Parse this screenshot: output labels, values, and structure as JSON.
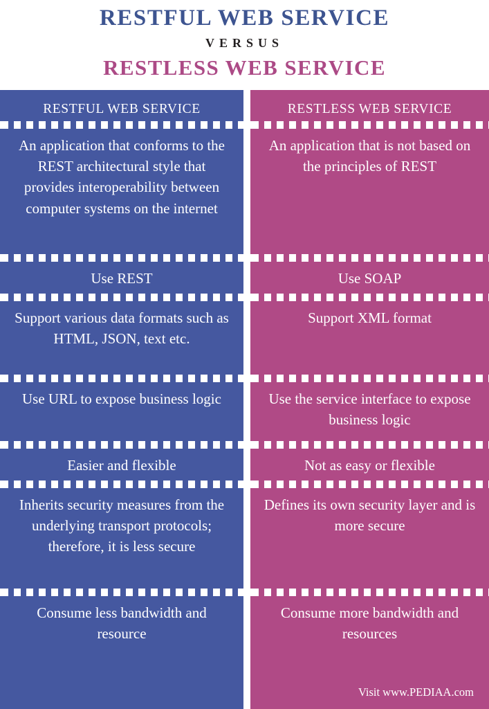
{
  "title": {
    "main": "RESTFUL WEB SERVICE",
    "versus": "VERSUS",
    "sub": "RESTLESS WEB SERVICE",
    "main_color": "#3d5490",
    "versus_color": "#231f20",
    "sub_color": "#ac4a86"
  },
  "theme": {
    "left_column_color": "#4558a0",
    "right_column_color": "#b04a86",
    "text_color": "#ffffff",
    "background": "#ffffff",
    "separator_style": "white-dashed"
  },
  "comparison": {
    "left_header": "RESTFUL WEB SERVICE",
    "right_header": "RESTLESS WEB SERVICE",
    "rows": [
      {
        "left": "An application that conforms to the REST architectural style that provides interoperability between computer systems on the internet",
        "right": "An application that is not based on the principles of REST"
      },
      {
        "left": "Use REST",
        "right": "Use SOAP"
      },
      {
        "left": "Support various data formats such as HTML, JSON, text etc.",
        "right": "Support XML format"
      },
      {
        "left": "Use URL to expose business logic",
        "right": "Use the service interface to expose business logic"
      },
      {
        "left": "Easier and flexible",
        "right": "Not as easy or flexible"
      },
      {
        "left": "Inherits security measures from the underlying transport protocols; therefore, it is less secure",
        "right": "Defines its own security layer and is more secure"
      },
      {
        "left": "Consume less bandwidth and resource",
        "right": "Consume more bandwidth and resources"
      }
    ]
  },
  "footer": {
    "visit_text": "Visit www.PEDIAA.com"
  }
}
